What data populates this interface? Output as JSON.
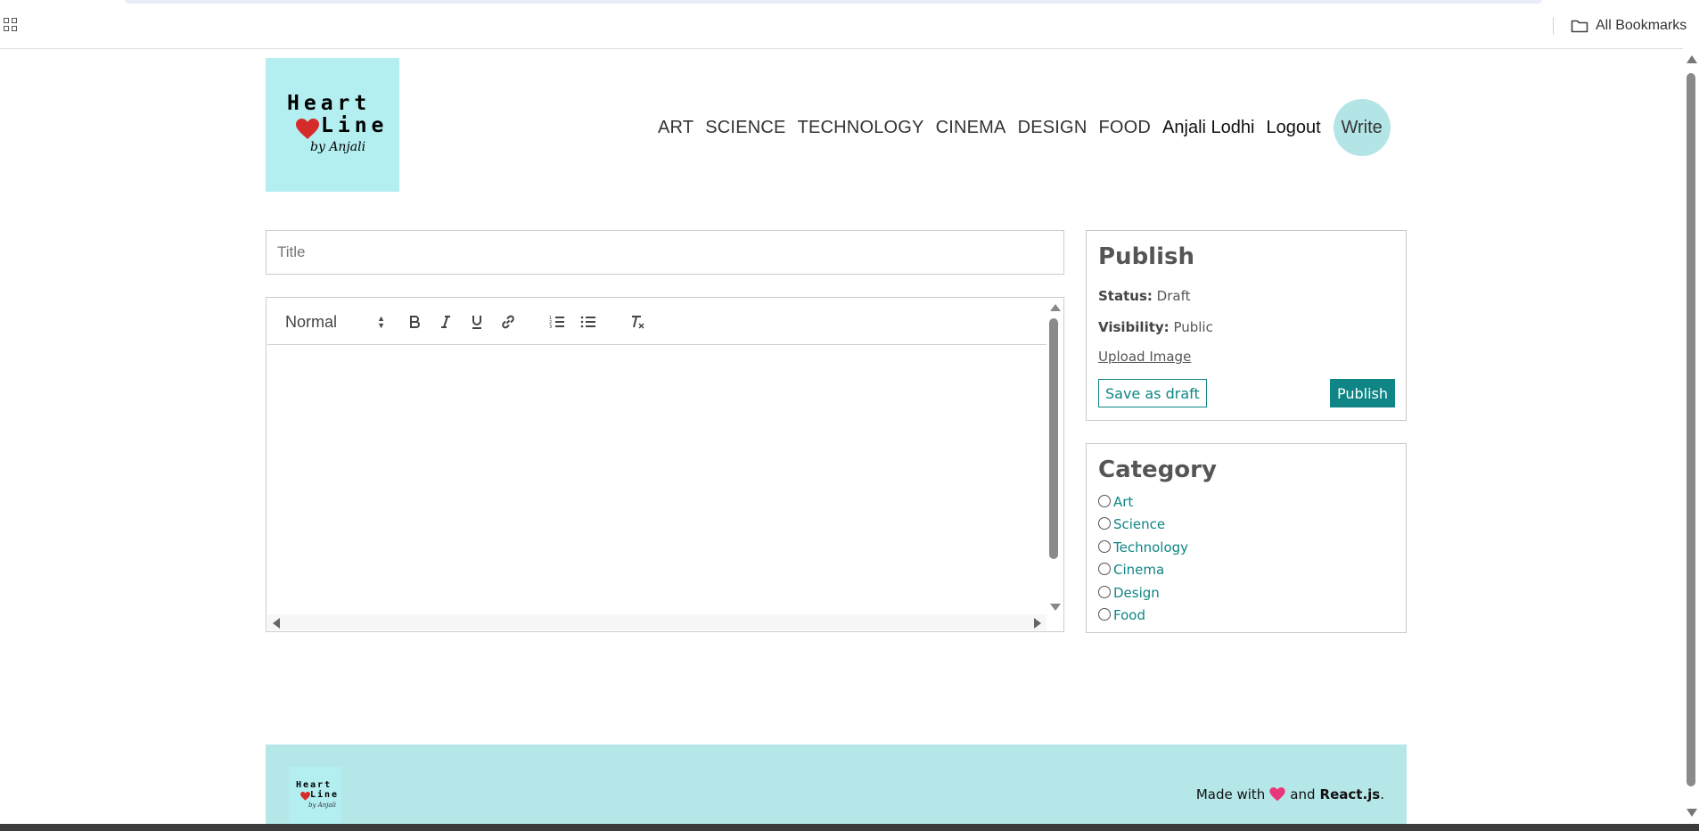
{
  "browser": {
    "bookmarks_label": "All Bookmarks",
    "apps_icon": "apps-grid-icon",
    "folder_icon": "folder-icon"
  },
  "header": {
    "logo": {
      "line1": "Heart",
      "line2": "Line",
      "line3": "by Anjali"
    },
    "nav": {
      "categories": [
        "ART",
        "SCIENCE",
        "TECHNOLOGY",
        "CINEMA",
        "DESIGN",
        "FOOD"
      ],
      "user": "Anjali Lodhi",
      "logout": "Logout",
      "write": "Write"
    }
  },
  "editor": {
    "title_placeholder": "Title",
    "title_value": "",
    "format_select": "Normal",
    "toolbar_icons": [
      "bold-icon",
      "italic-icon",
      "underline-icon",
      "link-icon",
      "ordered-list-icon",
      "bullet-list-icon",
      "clear-format-icon"
    ],
    "content": ""
  },
  "publish": {
    "heading": "Publish",
    "status_label": "Status:",
    "status_value": "Draft",
    "visibility_label": "Visibility:",
    "visibility_value": "Public",
    "upload_label": "Upload Image",
    "save_draft_label": "Save as draft",
    "publish_label": "Publish"
  },
  "category": {
    "heading": "Category",
    "items": [
      "Art",
      "Science",
      "Technology",
      "Cinema",
      "Design",
      "Food"
    ]
  },
  "footer": {
    "logo": {
      "line1": "Heart",
      "line2": "Line",
      "line3": "by Anjali"
    },
    "made_with": "Made with",
    "and": "and",
    "tech": "React.js",
    "period": "."
  },
  "colors": {
    "accent": "#0f8585",
    "logo_bg": "#b3eef0",
    "footer_bg": "#b6e7e8",
    "write_bg": "#b3e5e6",
    "heart": "#d62b2b"
  }
}
